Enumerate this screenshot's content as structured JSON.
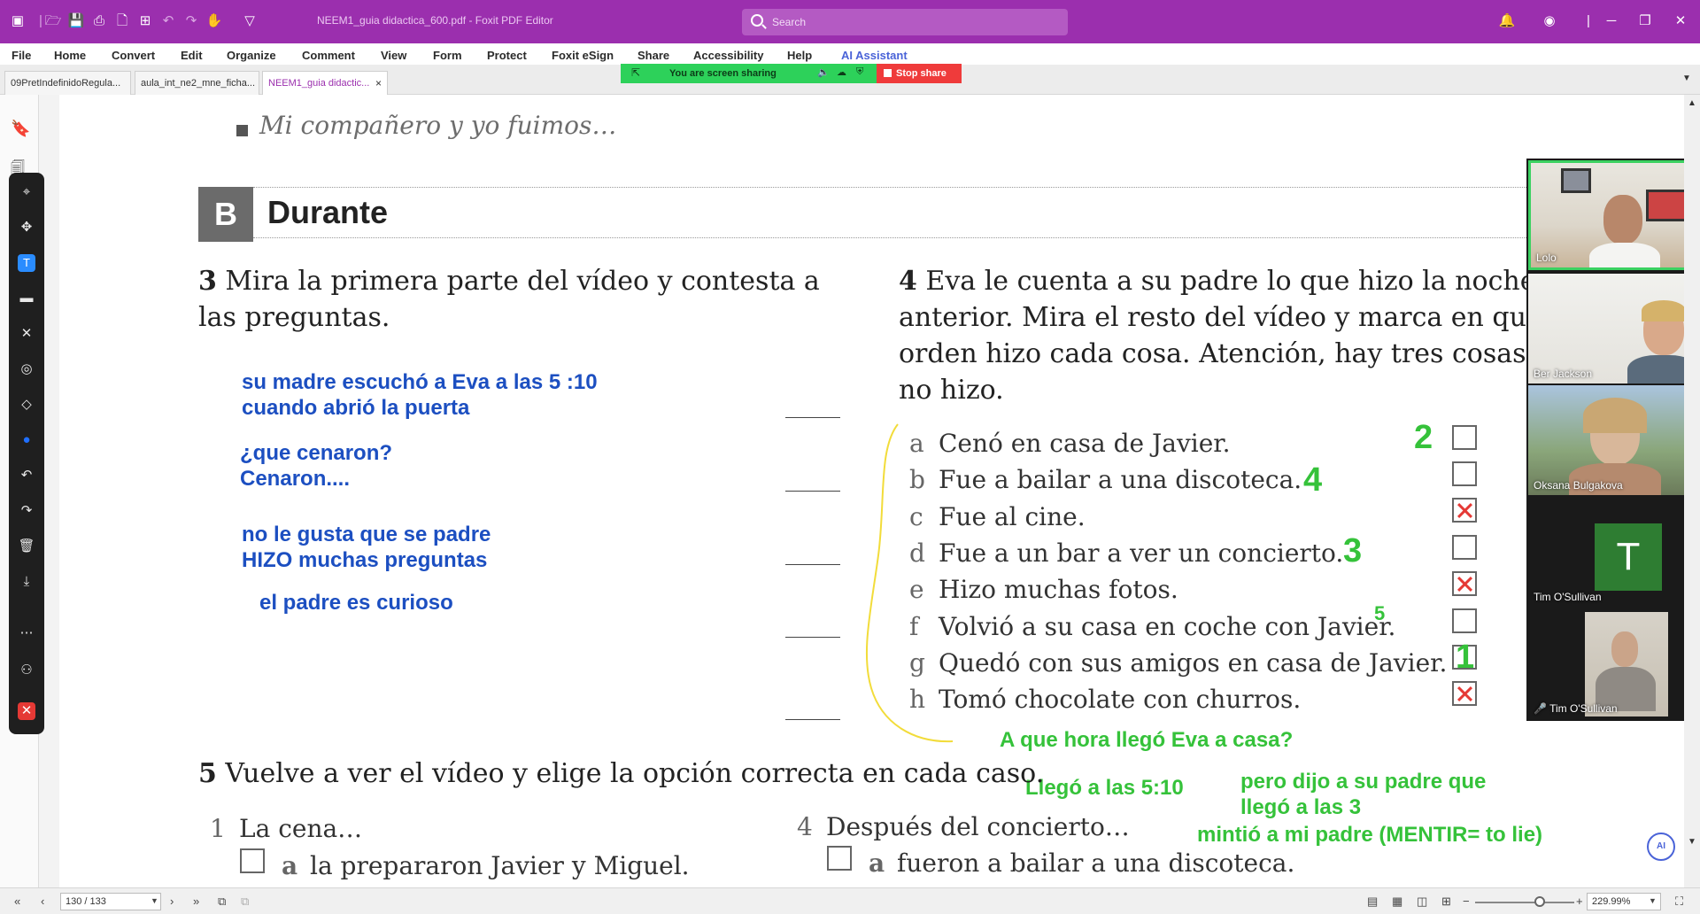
{
  "titlebar": {
    "doc_title": "NEEM1_guia didactica_600.pdf - Foxit PDF Editor",
    "search_placeholder": "Search"
  },
  "menu": [
    "File",
    "Home",
    "Convert",
    "Edit",
    "Organize",
    "Comment",
    "View",
    "Form",
    "Protect",
    "Foxit eSign",
    "Share",
    "Accessibility",
    "Help",
    "AI Assistant"
  ],
  "tabs": [
    {
      "label": "09PretIndefinidoRegula..."
    },
    {
      "label": "aula_int_ne2_mne_ficha..."
    },
    {
      "label": "NEEM1_guia didactic...",
      "close": "×"
    }
  ],
  "screen_share": {
    "status": "You are screen sharing",
    "stop": "Stop share"
  },
  "document": {
    "intro": "Mi compañero y yo fuimos…",
    "section_letter": "B",
    "section_title": "Durante",
    "ex3_num": "3",
    "ex3_text": "Mira la primera parte del vídeo y contesta a las preguntas.",
    "ex4_num": "4",
    "ex4_text": "Eva le cuenta a su padre lo que hizo la noche anterior. Mira el resto del vídeo y marca en qué orden hizo cada cosa. Atención, hay tres cosas que no hizo.",
    "answers": [
      "su madre escuchó a Eva a las 5 :10\ncuando abrió la puerta",
      "¿que cenaron?\nCenaron....",
      "no le gusta que se padre\nHIZO muchas preguntas",
      "el padre es curioso"
    ],
    "options": [
      {
        "letter": "a",
        "text": "Cenó en casa de Javier.",
        "checked": false
      },
      {
        "letter": "b",
        "text": "Fue a bailar a una discoteca.",
        "checked": false
      },
      {
        "letter": "c",
        "text": "Fue al cine.",
        "checked": true
      },
      {
        "letter": "d",
        "text": "Fue a un bar a ver un concierto.",
        "checked": false
      },
      {
        "letter": "e",
        "text": "Hizo muchas fotos.",
        "checked": true
      },
      {
        "letter": "f",
        "text": "Volvió a su casa en coche con Javier.",
        "checked": false
      },
      {
        "letter": "g",
        "text": "Quedó con sus amigos en casa de Javier.",
        "checked": false
      },
      {
        "letter": "h",
        "text": "Tomó chocolate con churros.",
        "checked": true
      }
    ],
    "order_marks": {
      "a": "2",
      "b": "4",
      "d": "3",
      "f": "5",
      "g": "1"
    },
    "green_notes": {
      "question": "A que hora llegó Eva a casa?",
      "arrival": "Llegó a las 5:10",
      "told": "pero dijo a su padre que\nllegó a las 3",
      "lied": "mintió a mi padre (MENTIR= to lie)"
    },
    "ex5_num": "5",
    "ex5_text": "Vuelve a ver el vídeo y elige la opción correcta en cada caso.",
    "q1_num": "1",
    "q1_text": "La cena…",
    "q1_a_letter": "a",
    "q1_a_text": "la prepararon Javier y Miguel.",
    "q4_num": "4",
    "q4_text": "Después del concierto…",
    "q4_a_letter": "a",
    "q4_a_text": "fueron a bailar a una discoteca."
  },
  "participants": [
    {
      "name": "Lolo",
      "speaking": true
    },
    {
      "name": "Ber Jackson",
      "speaking": false
    },
    {
      "name": "Oksana Bulgakova",
      "speaking": false
    },
    {
      "name": "Tim O'Sullivan",
      "initial": "T",
      "speaking": false
    },
    {
      "name": "Tim O'Sullivan",
      "speaking": false,
      "muted": true
    }
  ],
  "statusbar": {
    "page": "130 / 133",
    "zoom": "229.99%"
  },
  "colors": {
    "brand": "#9b2fae",
    "annotation_blue": "#1c4fc1",
    "annotation_green": "#35c23a",
    "check_red": "#e53935",
    "share_green": "#2dd15a"
  }
}
